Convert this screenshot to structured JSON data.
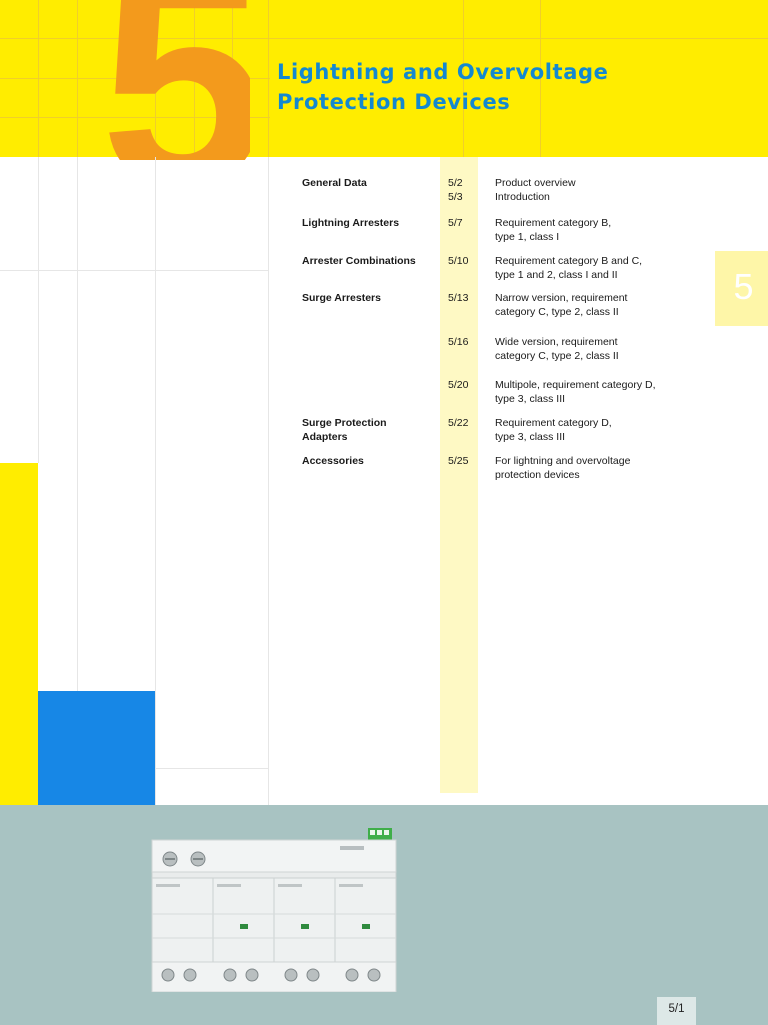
{
  "chapter": {
    "number": "5",
    "title_lines": [
      "Lightning and Overvoltage",
      "Protection Devices"
    ]
  },
  "toc": [
    {
      "section": [
        "General Data"
      ],
      "pages": [
        "5/2",
        "5/3"
      ],
      "description": [
        "Product overview",
        "Introduction"
      ]
    },
    {
      "section": [
        "Lightning Arresters"
      ],
      "pages": [
        "5/7"
      ],
      "description": [
        "Requirement category B,",
        "type 1, class I"
      ]
    },
    {
      "section": [
        "Arrester Combinations"
      ],
      "pages": [
        "5/10"
      ],
      "description": [
        "Requirement category B and C,",
        "type 1 and 2, class I and II"
      ]
    },
    {
      "section": [
        "Surge Arresters"
      ],
      "pages": [
        "5/13"
      ],
      "description": [
        "Narrow version, requirement",
        "category C, type 2, class II"
      ]
    },
    {
      "section": [],
      "pages": [
        "5/16"
      ],
      "description": [
        "Wide version, requirement",
        "category C, type 2, class II"
      ]
    },
    {
      "section": [],
      "pages": [
        "5/20"
      ],
      "description": [
        "Multipole, requirement category D,",
        "type 3, class III"
      ]
    },
    {
      "section": [
        "Surge Protection",
        "Adapters"
      ],
      "pages": [
        "5/22"
      ],
      "description": [
        "Requirement category D,",
        "type 3, class III"
      ]
    },
    {
      "section": [
        "Accessories"
      ],
      "pages": [
        "5/25"
      ],
      "description": [
        "For lightning and overvoltage",
        "protection devices"
      ]
    }
  ],
  "side_tab": {
    "label": "5"
  },
  "footer": {
    "page_number": "5/1"
  },
  "colors": {
    "yellow": "#ffed00",
    "orange": "#f39a1c",
    "title_blue": "#1488d0",
    "blue_block": "#1787e6",
    "band": "#a8c3c2"
  }
}
